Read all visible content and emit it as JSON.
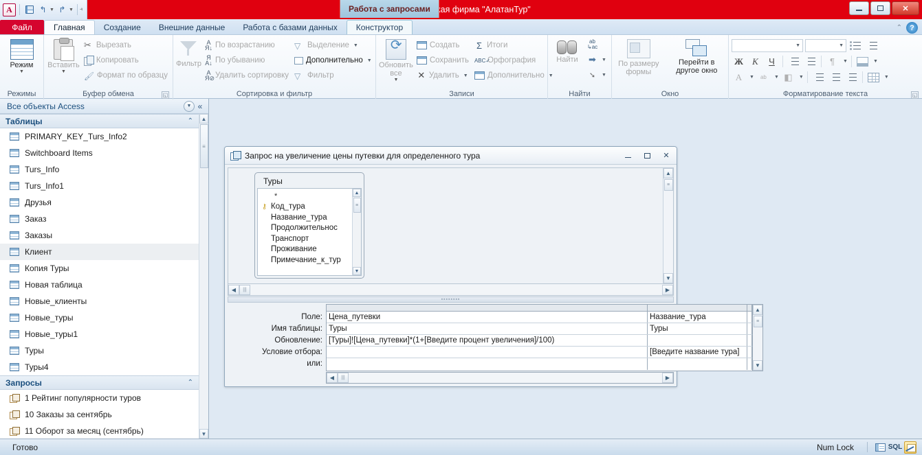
{
  "window": {
    "title": "Туристическая фирма \"АлатанТур\"",
    "contextual_tab_title": "Работа с запросами",
    "minimize_label": "Свернуть",
    "restore_label": "Свернуть в окно",
    "close_label": "Закрыть"
  },
  "quick_access": {
    "app_letter": "A",
    "save_icon": "save-icon",
    "undo_icon": "undo-icon",
    "redo_icon": "redo-icon",
    "customize_icon": "customize-qat-icon"
  },
  "tabs": {
    "file": "Файл",
    "items": [
      {
        "label": "Главная",
        "active": true
      },
      {
        "label": "Создание",
        "active": false
      },
      {
        "label": "Внешние данные",
        "active": false
      },
      {
        "label": "Работа с базами данных",
        "active": false
      }
    ],
    "contextual": {
      "label": "Конструктор",
      "active": false
    }
  },
  "ribbon": {
    "help_icon": "help-icon",
    "collapse_icon": "collapse-ribbon-icon",
    "groups": [
      {
        "name": "Режимы",
        "label": "Режимы",
        "big_button": {
          "label": "Режим",
          "icon": "view-table-icon"
        }
      },
      {
        "name": "Буфер обмена",
        "label": "Буфер обмена",
        "big_button": {
          "label": "Вставить",
          "icon": "paste-icon",
          "disabled": true
        },
        "items": [
          {
            "label": "Вырезать",
            "icon": "scissors-icon",
            "disabled": true
          },
          {
            "label": "Копировать",
            "icon": "copy-icon",
            "disabled": true
          },
          {
            "label": "Формат по образцу",
            "icon": "format-painter-icon",
            "disabled": true
          }
        ]
      },
      {
        "name": "Сортировка и фильтр",
        "label": "Сортировка и фильтр",
        "big_button": {
          "label": "Фильтр",
          "icon": "filter-funnel-icon",
          "disabled": true
        },
        "items": [
          {
            "label": "По возрастанию",
            "icon": "sort-ascending-icon",
            "disabled": true
          },
          {
            "label": "По убыванию",
            "icon": "sort-descending-icon",
            "disabled": true
          },
          {
            "label": "Удалить сортировку",
            "icon": "clear-sort-icon",
            "disabled": true
          },
          {
            "label": "Выделение",
            "icon": "selection-icon",
            "disabled": true
          },
          {
            "label": "Дополнительно",
            "icon": "advanced-filter-icon",
            "disabled": false
          },
          {
            "label": "Фильтр",
            "icon": "toggle-filter-icon",
            "disabled": true
          }
        ]
      },
      {
        "name": "Записи",
        "label": "Записи",
        "big_button": {
          "label": "Обновить все",
          "icon": "refresh-all-icon",
          "disabled": true
        },
        "items": [
          {
            "label": "Создать",
            "icon": "new-record-icon",
            "disabled": true
          },
          {
            "label": "Сохранить",
            "icon": "save-record-icon",
            "disabled": true
          },
          {
            "label": "Удалить",
            "icon": "delete-record-icon",
            "disabled": true
          },
          {
            "label": "Итоги",
            "icon": "totals-sigma-icon",
            "disabled": true
          },
          {
            "label": "Орфография",
            "icon": "spelling-icon",
            "disabled": true
          },
          {
            "label": "Дополнительно",
            "icon": "more-records-icon",
            "disabled": true
          }
        ]
      },
      {
        "name": "Найти",
        "label": "Найти",
        "big_button": {
          "label": "Найти",
          "icon": "binoculars-icon",
          "disabled": true
        },
        "items": [
          {
            "label": "",
            "icon": "replace-icon",
            "disabled": true
          },
          {
            "label": "",
            "icon": "goto-arrow-icon",
            "disabled": true
          },
          {
            "label": "",
            "icon": "select-cursor-icon",
            "disabled": true
          }
        ]
      },
      {
        "name": "Окно",
        "label": "Окно",
        "buttons": [
          {
            "label": "По размеру формы",
            "icon": "size-to-form-icon",
            "disabled": true
          },
          {
            "label": "Перейти в другое окно",
            "icon": "switch-windows-icon",
            "disabled": false
          }
        ]
      },
      {
        "name": "Форматирование текста",
        "label": "Форматирование текста",
        "font_box_value": "",
        "size_box_value": "",
        "buttons": [
          {
            "label": "Ж",
            "name": "bold-button"
          },
          {
            "label": "К",
            "name": "italic-button"
          },
          {
            "label": "Ч",
            "name": "underline-button"
          },
          {
            "label": "A",
            "name": "font-color-button"
          }
        ]
      }
    ]
  },
  "nav_pane": {
    "title": "Все объекты Access",
    "dropdown_icon": "nav-dropdown-icon",
    "collapse_icon": "shutter-bar-collapse-icon",
    "groups": [
      {
        "name": "Таблицы",
        "collapse_icon": "chevron-up-icon",
        "items": [
          {
            "label": "PRIMARY_KEY_Turs_Info2",
            "icon": "table-icon",
            "selected": false
          },
          {
            "label": "Switchboard Items",
            "icon": "table-icon",
            "selected": false
          },
          {
            "label": "Turs_Info",
            "icon": "table-icon",
            "selected": false
          },
          {
            "label": "Turs_Info1",
            "icon": "table-icon",
            "selected": false
          },
          {
            "label": "Друзья",
            "icon": "table-icon",
            "selected": false
          },
          {
            "label": "Заказ",
            "icon": "table-icon",
            "selected": false
          },
          {
            "label": "Заказы",
            "icon": "table-icon",
            "selected": false
          },
          {
            "label": "Клиент",
            "icon": "table-icon",
            "selected": true
          },
          {
            "label": "Копия Туры",
            "icon": "table-icon",
            "selected": false
          },
          {
            "label": "Новая таблица",
            "icon": "table-icon",
            "selected": false
          },
          {
            "label": "Новые_клиенты",
            "icon": "table-icon",
            "selected": false
          },
          {
            "label": "Новые_туры",
            "icon": "table-icon",
            "selected": false
          },
          {
            "label": "Новые_туры1",
            "icon": "table-icon",
            "selected": false
          },
          {
            "label": "Туры",
            "icon": "table-icon",
            "selected": false
          },
          {
            "label": "Туры4",
            "icon": "table-icon",
            "selected": false
          }
        ]
      },
      {
        "name": "Запросы",
        "collapse_icon": "chevron-up-icon",
        "items": [
          {
            "label": "1 Рейтинг популярности туров",
            "icon": "query-icon",
            "selected": false
          },
          {
            "label": "10 Заказы за сентябрь",
            "icon": "query-icon",
            "selected": false
          },
          {
            "label": "11 Оборот за месяц (сентябрь)",
            "icon": "query-icon",
            "selected": false
          }
        ]
      }
    ]
  },
  "query_window": {
    "title": "Запрос на увеличение цены путевки для определенного тура",
    "icon": "query-design-icon",
    "minimize_label": "Свернуть",
    "restore_label": "Восстановить",
    "close_label": "Закрыть",
    "table_box": {
      "title": "Туры",
      "fields": [
        "*",
        "Код_тура",
        "Название_тура",
        "Продолжительнос",
        "Транспорт",
        "Проживание",
        "Примечание_к_тур"
      ],
      "primary_key_field": "Код_тура",
      "key_icon": "primary-key-icon"
    },
    "grid": {
      "row_labels": [
        "Поле:",
        "Имя таблицы:",
        "Обновление:",
        "Условие отбора:",
        "или:"
      ],
      "columns": [
        {
          "field": "Цена_путевки",
          "table": "Туры",
          "update_to": "[Туры]![Цена_путевки]*(1+[Введите процент увеличения]/100)",
          "criteria": "",
          "or": ""
        },
        {
          "field": "Название_тура",
          "table": "Туры",
          "update_to": "",
          "criteria": "[Введите название тура]",
          "or": ""
        },
        {
          "field": "",
          "table": "",
          "update_to": "",
          "criteria": "",
          "or": ""
        }
      ]
    }
  },
  "status_bar": {
    "message": "Готово",
    "num_lock": "Num Lock",
    "view_buttons": [
      {
        "name": "datasheet-view-button",
        "label": ""
      },
      {
        "name": "sql-view-button",
        "label": "SQL"
      },
      {
        "name": "design-view-button",
        "label": "",
        "active": true
      }
    ]
  }
}
